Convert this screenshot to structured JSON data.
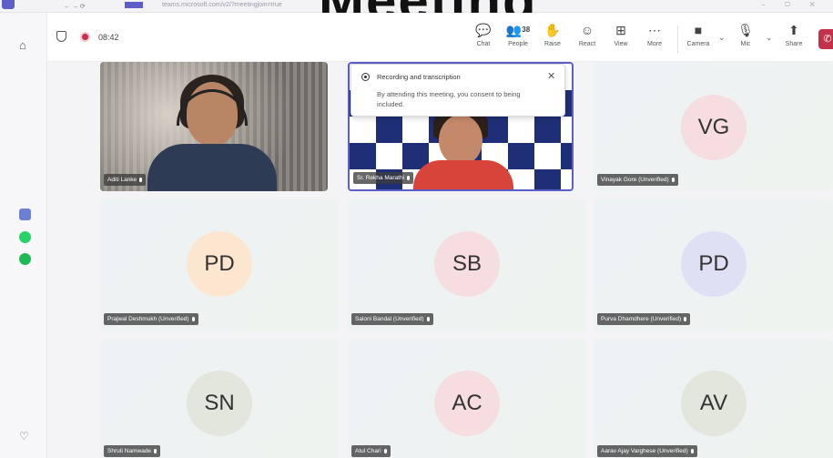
{
  "browser": {
    "url": "teams.microsoft.com/v2/?meetingjoin=true",
    "controls": "⎯ ▢ ✕"
  },
  "title_overlay": "Meeting",
  "meeting": {
    "timer": "08:42",
    "toolbar": [
      {
        "label": "Chat",
        "icon": "chat-icon",
        "glyph": "💬"
      },
      {
        "label": "People",
        "icon": "people-icon",
        "glyph": "👥",
        "count": "38"
      },
      {
        "label": "Raise",
        "icon": "raise-hand-icon",
        "glyph": "✋"
      },
      {
        "label": "React",
        "icon": "react-icon",
        "glyph": "☺"
      },
      {
        "label": "View",
        "icon": "view-icon",
        "glyph": "⊞"
      },
      {
        "label": "More",
        "icon": "more-icon",
        "glyph": "⋯"
      },
      {
        "label": "Camera",
        "icon": "camera-icon",
        "glyph": "■"
      },
      {
        "label": "Mic",
        "icon": "mic-icon",
        "glyph": "🎙"
      },
      {
        "label": "Share",
        "icon": "share-icon",
        "glyph": "⬆"
      }
    ],
    "leave_label": "✆"
  },
  "popover": {
    "title": "Recording and transcription",
    "text": "By attending this meeting, you consent to being included.",
    "close": "✕"
  },
  "participants": [
    {
      "name": "Aditi Lanke",
      "initials": "",
      "video": true
    },
    {
      "name": "Sr. Rekha Marathi",
      "initials": "",
      "video": true
    },
    {
      "name": "Vinayak Gore (Unverified)",
      "initials": "VG",
      "color": "#f6dde0"
    },
    {
      "name": "Prajwal Deshmukh (Unverified)",
      "initials": "PD",
      "color": "#fde6cf"
    },
    {
      "name": "Saloni Bandal (Unverified)",
      "initials": "SB",
      "color": "#f6dde0"
    },
    {
      "name": "Purva Dhamdhere (Unverified)",
      "initials": "PD",
      "color": "#e0e0f4"
    },
    {
      "name": "Shruti Namwade",
      "initials": "SN",
      "color": "#e2e6dc"
    },
    {
      "name": "Atul Chari",
      "initials": "AC",
      "color": "#f6dde0"
    },
    {
      "name": "Aarav Ajay Varghese (Unverified)",
      "initials": "AV",
      "color": "#e2e6dc"
    }
  ]
}
